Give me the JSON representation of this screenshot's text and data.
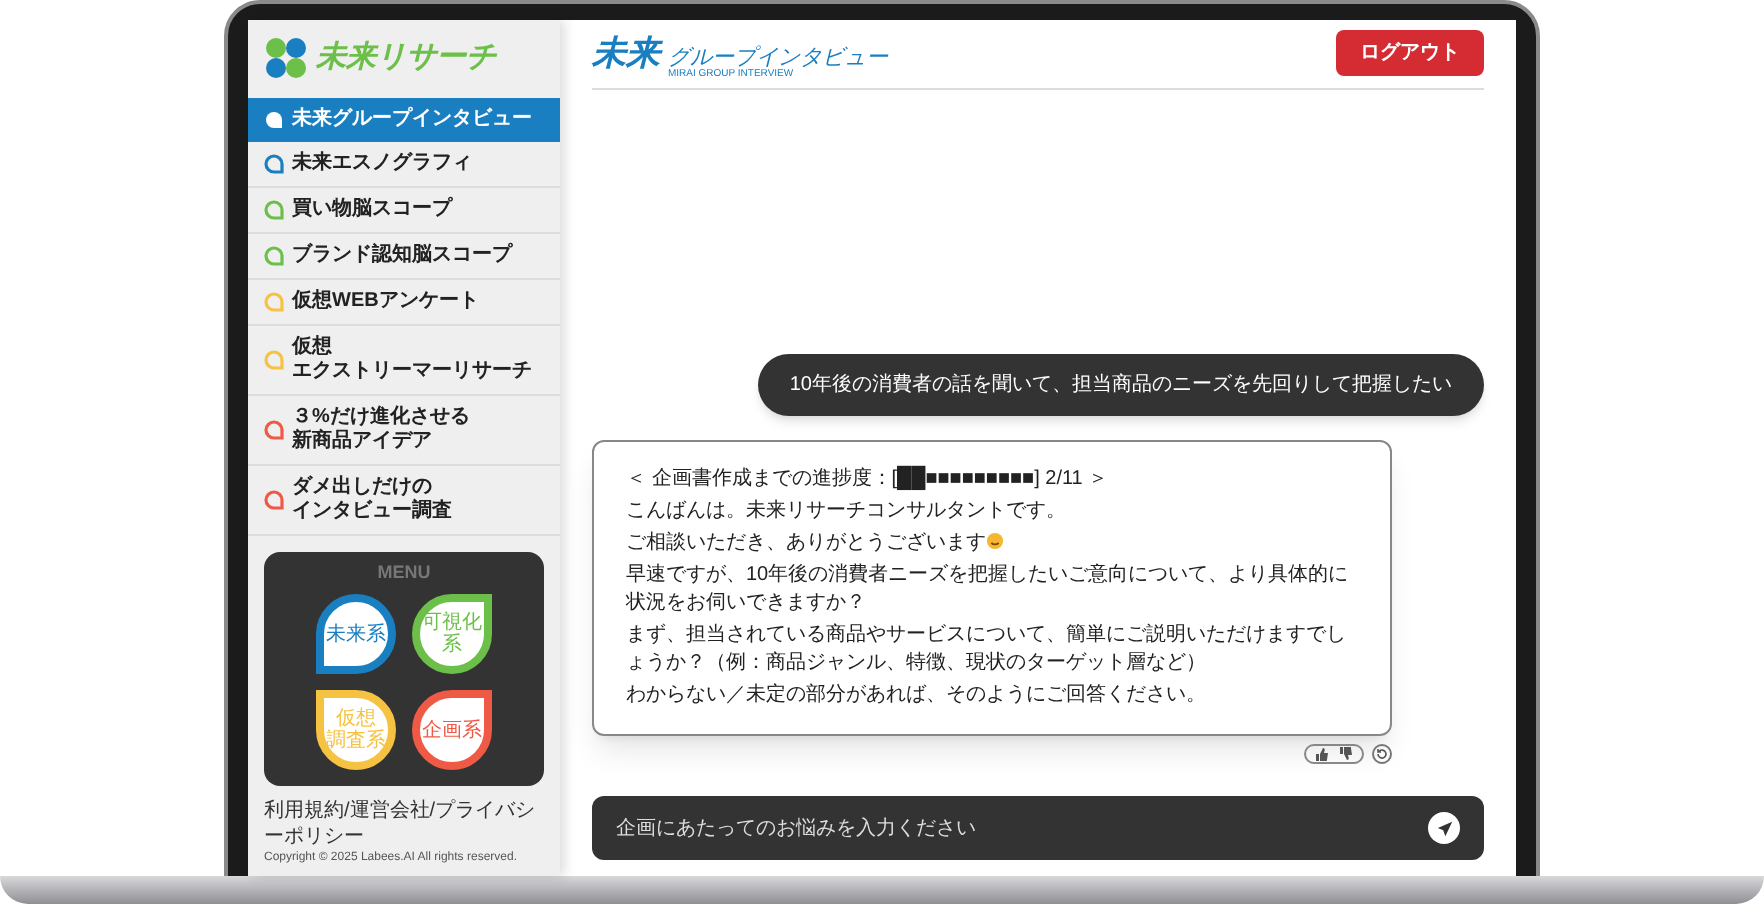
{
  "sidebar": {
    "logo": "未来リサーチ",
    "items": [
      {
        "label": "未来グループインタビュー",
        "selected": true,
        "color": "#1a7fc1"
      },
      {
        "label": "未来エスノグラフィ",
        "selected": false,
        "color": "#1a7fc1"
      },
      {
        "label": "買い物脳スコープ",
        "selected": false,
        "color": "#6cc04a"
      },
      {
        "label": "ブランド認知脳スコープ",
        "selected": false,
        "color": "#6cc04a"
      },
      {
        "label": "仮想WEBアンケート",
        "selected": false,
        "color": "#f5c242"
      },
      {
        "label_lines": [
          "仮想",
          "エクストリーマーリサーチ"
        ],
        "selected": false,
        "color": "#f5c242"
      },
      {
        "label_lines": [
          "３%だけ進化させる",
          "新商品アイデア"
        ],
        "selected": false,
        "color": "#ee5a45"
      },
      {
        "label_lines": [
          "ダメ出しだけの",
          "インタビュー調査"
        ],
        "selected": false,
        "color": "#ee5a45"
      }
    ],
    "menu": {
      "title": "MENU",
      "tiles": [
        {
          "label": "未来系",
          "color": "#1a7fc1"
        },
        {
          "label": "可視化系",
          "color": "#6cc04a"
        },
        {
          "label_lines": [
            "仮想",
            "調査系"
          ],
          "color": "#f5c242"
        },
        {
          "label": "企画系",
          "color": "#ee5a45"
        }
      ]
    },
    "footer_links": "利用規約/運営会社/プライバシーポリシー",
    "copyright": "Copyright © 2025 Labees.AI All rights reserved."
  },
  "header": {
    "logo_main": "未来",
    "logo_sub": "グループインタビュー",
    "logo_tagline": "MIRAI GROUP INTERVIEW",
    "logout_button": "ログアウト"
  },
  "chat": {
    "user_message": "10年後の消費者の話を聞いて、担当商品のニーズを先回りして把握したい",
    "bot_message": {
      "progress": "＜ 企画書作成までの進捗度：[██■■■■■■■■■] 2/11 ＞",
      "paragraphs": [
        "こんばんは。未来リサーチコンサルタントです。",
        "ご相談いただき、ありがとうございます",
        "早速ですが、10年後の消費者ニーズを把握したいご意向について、より具体的に状況をお伺いできますか？",
        "まず、担当されている商品やサービスについて、簡単にご説明いただけますでしょうか？（例：商品ジャンル、特徴、現状のターゲット層など）",
        "わからない／未定の部分があれば、そのようにご回答ください。"
      ]
    },
    "input": {
      "placeholder": "企画にあたってのお悩みを入力ください"
    }
  }
}
